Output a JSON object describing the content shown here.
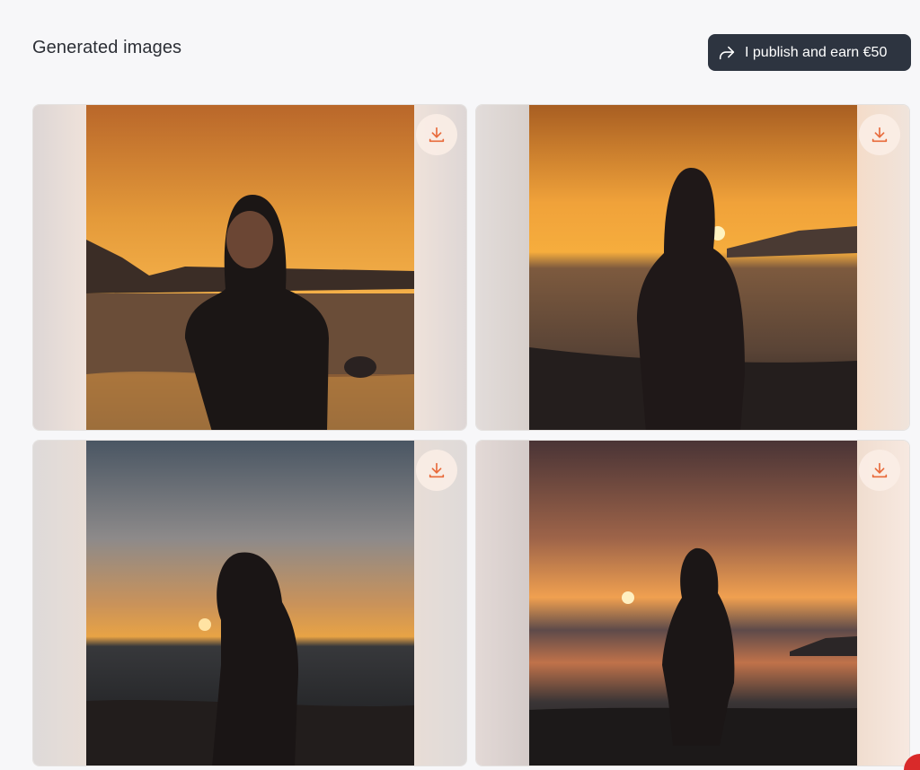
{
  "header": {
    "title": "Generated images",
    "publish_button_label": "I publish and earn €50"
  },
  "icons": {
    "share": "share-arrow-icon",
    "download": "download-icon"
  },
  "colors": {
    "accent": "#e86a3a",
    "button_dark": "#2d3440",
    "page_bg": "#f7f7f9"
  },
  "images": [
    {
      "alt": "Woman smiling at sunset on beach",
      "download_label": "Download"
    },
    {
      "alt": "Woman in profile facing the setting sun",
      "download_label": "Download"
    },
    {
      "alt": "Woman silhouette in profile with sun over sea",
      "download_label": "Download"
    },
    {
      "alt": "Woman standing on beach facing sunset",
      "download_label": "Download"
    }
  ]
}
